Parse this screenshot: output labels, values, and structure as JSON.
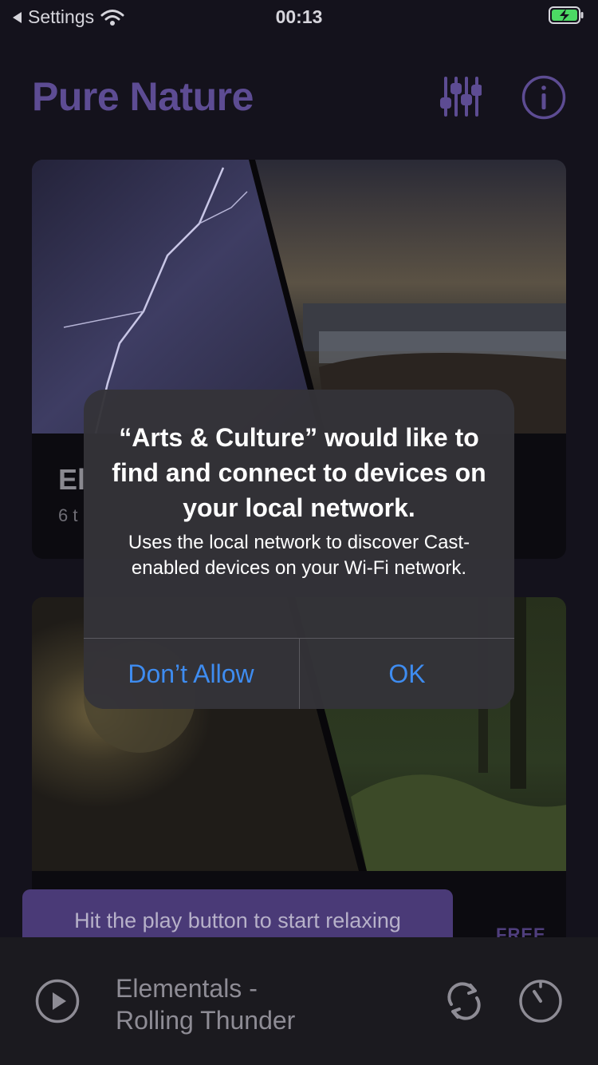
{
  "status_bar": {
    "back_label": "Settings",
    "time": "00:13"
  },
  "header": {
    "title": "Pure Nature"
  },
  "cards": [
    {
      "title": "El",
      "subtitle": "6 t"
    },
    {
      "badge": "FREE"
    }
  ],
  "tooltip": {
    "text": "Hit the play button to start relaxing"
  },
  "player": {
    "track_title_line1": "Elementals -",
    "track_title_line2": "Rolling Thunder"
  },
  "alert": {
    "title": "“Arts & Culture” would like to find and connect to devices on your local network.",
    "message": "Uses the local network to discover Cast-enabled devices on your Wi-Fi network.",
    "deny_label": "Don’t Allow",
    "ok_label": "OK"
  },
  "colors": {
    "accent": "#5d4c93",
    "alert_button": "#3e8cf0",
    "battery": "#4cd964"
  }
}
